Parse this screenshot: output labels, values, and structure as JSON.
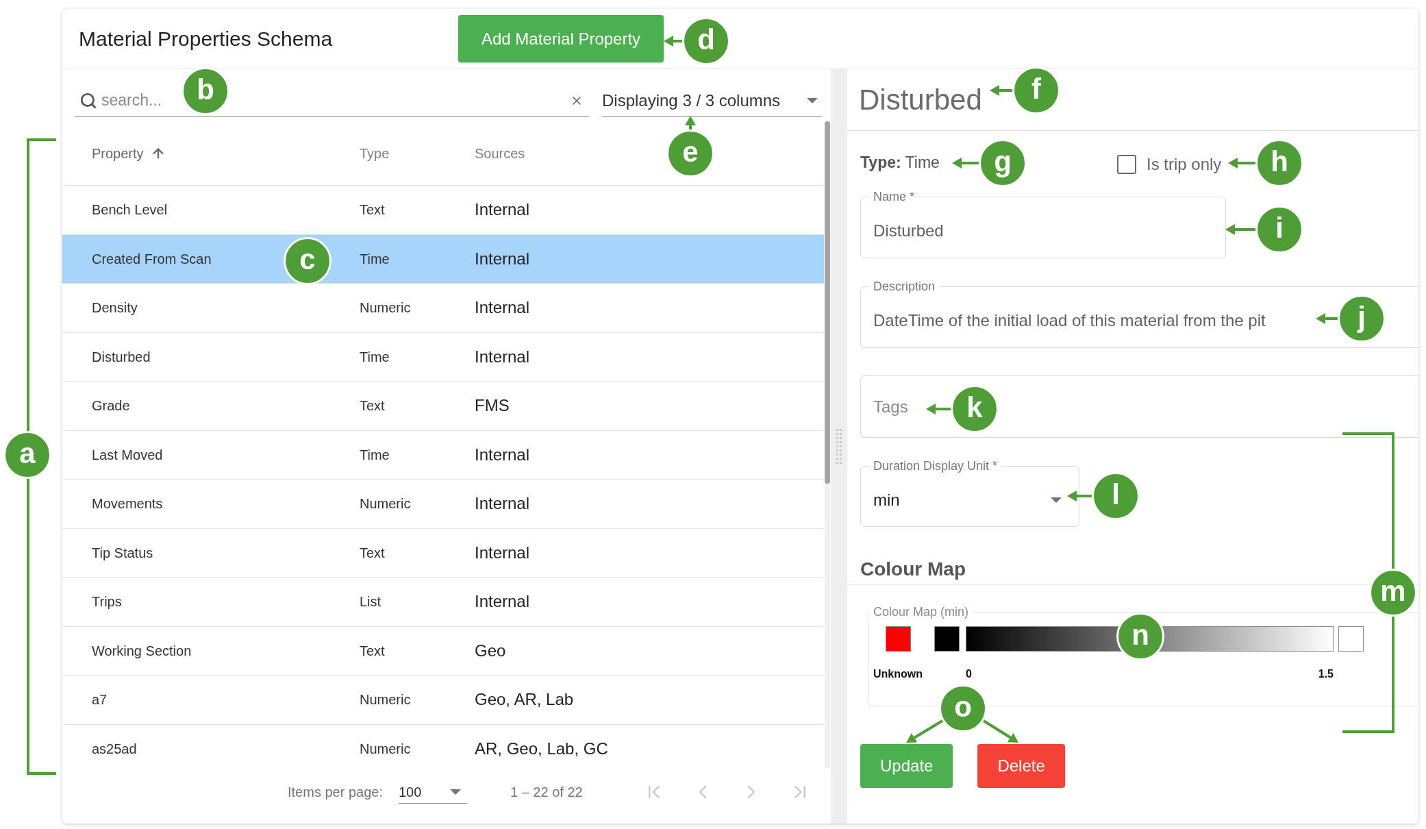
{
  "header": {
    "title": "Material Properties Schema",
    "add_button": "Add Material Property"
  },
  "search": {
    "placeholder": "search..."
  },
  "column_select": {
    "value": "Displaying 3 / 3 columns"
  },
  "table": {
    "columns": [
      {
        "label": "Property",
        "sorted": true
      },
      {
        "label": "Type",
        "sorted": false
      },
      {
        "label": "Sources",
        "sorted": false
      }
    ],
    "rows": [
      {
        "property": "Bench Level",
        "type": "Text",
        "sources": "Internal",
        "selected": false
      },
      {
        "property": "Created From Scan",
        "type": "Time",
        "sources": "Internal",
        "selected": true
      },
      {
        "property": "Density",
        "type": "Numeric",
        "sources": "Internal",
        "selected": false
      },
      {
        "property": "Disturbed",
        "type": "Time",
        "sources": "Internal",
        "selected": false
      },
      {
        "property": "Grade",
        "type": "Text",
        "sources": "FMS",
        "selected": false
      },
      {
        "property": "Last Moved",
        "type": "Time",
        "sources": "Internal",
        "selected": false
      },
      {
        "property": "Movements",
        "type": "Numeric",
        "sources": "Internal",
        "selected": false
      },
      {
        "property": "Tip Status",
        "type": "Text",
        "sources": "Internal",
        "selected": false
      },
      {
        "property": "Trips",
        "type": "List",
        "sources": "Internal",
        "selected": false
      },
      {
        "property": "Working Section",
        "type": "Text",
        "sources": "Geo",
        "selected": false
      },
      {
        "property": "a7",
        "type": "Numeric",
        "sources": "Geo, AR, Lab",
        "selected": false
      },
      {
        "property": "as25ad",
        "type": "Numeric",
        "sources": "AR, Geo, Lab, GC",
        "selected": false
      }
    ]
  },
  "pagination": {
    "items_per_page_label": "Items per page:",
    "page_size": "100",
    "range": "1 – 22 of 22",
    "nav": [
      {
        "kind": "first",
        "disabled": true
      },
      {
        "kind": "previous",
        "disabled": true
      },
      {
        "kind": "next",
        "disabled": true
      },
      {
        "kind": "last",
        "disabled": true
      }
    ]
  },
  "detail": {
    "title": "Disturbed",
    "type_line": "**Type:** Time",
    "trip_only": {
      "label": "Is trip only",
      "checked": false
    },
    "name": {
      "label": "Name *",
      "value": "Disturbed"
    },
    "description": {
      "label": "Description",
      "value": "DateTime of the initial load of this material from the pit"
    },
    "tags": {
      "placeholder": "Tags"
    },
    "duration_unit": {
      "label": "Duration Display Unit *",
      "value": "min"
    },
    "colour_map": {
      "heading": "Colour Map",
      "label": "Colour Map (min)",
      "unknown": {
        "label": "Unknown",
        "color": "#ff0000"
      },
      "scale": [
        {
          "label": "0",
          "color": "#000000"
        },
        {
          "label": "1.5",
          "color": "#ffffff"
        }
      ]
    },
    "buttons": [
      {
        "label": "Update",
        "kind": "primary"
      },
      {
        "label": "Delete",
        "kind": "danger"
      }
    ]
  },
  "annotations": [
    {
      "label": "a"
    },
    {
      "label": "b"
    },
    {
      "label": "c"
    },
    {
      "label": "d"
    },
    {
      "label": "e"
    },
    {
      "label": "f"
    },
    {
      "label": "g"
    },
    {
      "label": "h"
    },
    {
      "label": "i"
    },
    {
      "label": "j"
    },
    {
      "label": "k"
    },
    {
      "label": "l"
    },
    {
      "label": "m"
    },
    {
      "label": "n"
    },
    {
      "label": "o"
    }
  ]
}
